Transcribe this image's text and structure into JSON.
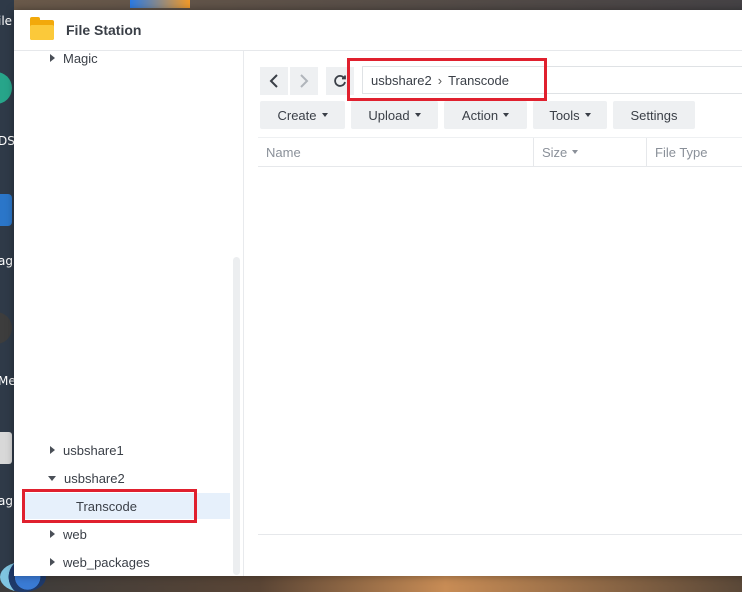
{
  "window": {
    "title": "File Station"
  },
  "desktop": {
    "labels": [
      "ile",
      "DS",
      "ag",
      "Me",
      "ag"
    ]
  },
  "sidebar": {
    "items": [
      {
        "label": "Magic",
        "state": "collapsed"
      },
      {
        "label": "usbshare1",
        "state": "collapsed"
      },
      {
        "label": "usbshare2",
        "state": "expanded"
      },
      {
        "label": "Transcode",
        "state": "selected"
      },
      {
        "label": "web",
        "state": "collapsed"
      },
      {
        "label": "web_packages",
        "state": "collapsed"
      }
    ]
  },
  "toolbar": {
    "path": [
      "usbshare2",
      "Transcode"
    ],
    "path_separator": "›",
    "buttons": [
      {
        "label": "Create"
      },
      {
        "label": "Upload"
      },
      {
        "label": "Action"
      },
      {
        "label": "Tools"
      },
      {
        "label": "Settings"
      }
    ]
  },
  "table": {
    "columns": [
      "Name",
      "Size",
      "File Type"
    ],
    "rows": []
  },
  "colors": {
    "highlight": "#e0202e",
    "selected_bg": "#e6f0fb",
    "folder": "#f2a90b"
  }
}
